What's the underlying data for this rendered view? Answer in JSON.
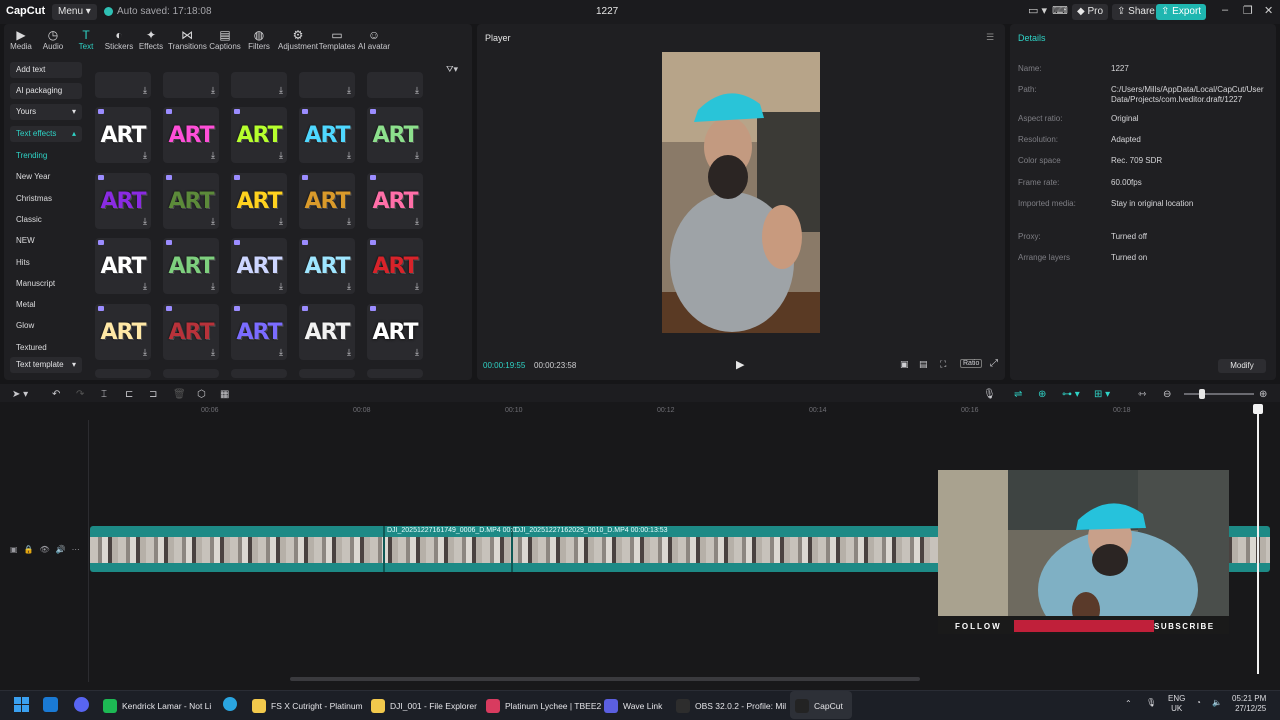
{
  "titlebar": {
    "logo": "CapCut",
    "menu": "Menu",
    "autosave": "Auto saved: 17:18:08",
    "project_title": "1227",
    "pro": "Pro",
    "share": "Share",
    "export": "Export"
  },
  "toolbar": [
    {
      "label": "Media",
      "icon": "media-icon"
    },
    {
      "label": "Audio",
      "icon": "audio-icon"
    },
    {
      "label": "Text",
      "icon": "text-icon",
      "active": true
    },
    {
      "label": "Stickers",
      "icon": "stickers-icon"
    },
    {
      "label": "Effects",
      "icon": "effects-icon"
    },
    {
      "label": "Transitions",
      "icon": "transitions-icon"
    },
    {
      "label": "Captions",
      "icon": "captions-icon"
    },
    {
      "label": "Filters",
      "icon": "filters-icon"
    },
    {
      "label": "Adjustment",
      "icon": "adjustment-icon"
    },
    {
      "label": "Templates",
      "icon": "templates-icon"
    },
    {
      "label": "AI avatar",
      "icon": "ai-avatar-icon"
    }
  ],
  "sidebar": {
    "add_text": "Add text",
    "ai_packaging": "AI packaging",
    "yours": "Yours",
    "text_effects": "Text effects",
    "categories": [
      "Trending",
      "New Year",
      "Christmas",
      "Classic",
      "NEW",
      "Hits",
      "Manuscript",
      "Metal",
      "Glow",
      "Textured"
    ],
    "text_template": "Text template"
  },
  "effects_grid": {
    "tile_text": "ART",
    "colors": [
      "#ffffff",
      "#ff4fd8",
      "#b6ff2e",
      "#4fd8ff",
      "#8de08d",
      "#8a2be2",
      "#5c8a3a",
      "#ffd21f",
      "#d99a2b",
      "#ff6fa8",
      "#ffffff",
      "#7ed07e",
      "#cdd6ff",
      "#9fe6ff",
      "#d8232a",
      "#ffe8a6",
      "#b8323a",
      "#7b6cff",
      "#f2f2f2",
      "#ffffff"
    ]
  },
  "player": {
    "title": "Player",
    "current_time": "00:00:19:55",
    "total_time": "00:00:23:58",
    "ratio": "Ratio"
  },
  "details": {
    "title": "Details",
    "rows": [
      {
        "label": "Name:",
        "value": "1227"
      },
      {
        "label": "Path:",
        "value": "C:/Users/Mills/AppData/Local/CapCut/User Data/Projects/com.lveditor.draft/1227"
      },
      {
        "label": "Aspect ratio:",
        "value": "Original"
      },
      {
        "label": "Resolution:",
        "value": "Adapted"
      },
      {
        "label": "Color space",
        "value": "Rec. 709 SDR"
      },
      {
        "label": "Frame rate:",
        "value": "60.00fps"
      },
      {
        "label": "Imported media:",
        "value": "Stay in original location"
      },
      {
        "label": "Proxy:",
        "value": "Turned off"
      },
      {
        "label": "Arrange layers",
        "value": "Turned on"
      }
    ],
    "modify": "Modify"
  },
  "timeline": {
    "ruler": [
      "00:06",
      "00:08",
      "00:10",
      "00:12",
      "00:14",
      "00:16",
      "00:18"
    ],
    "clip1": "DJI_20251227161749_0006_D.MP4  00:0",
    "clip2": "DJI_20251227162029_0010_D.MP4  00:00:13:53"
  },
  "overlay": {
    "follow": "FOLLOW",
    "subscribe": "SUBSCRIBE"
  },
  "taskbar": {
    "apps": [
      "Kendrick Lamar - Not Li",
      "FS X Cutright - Platinum",
      "DJI_001 - File Explorer",
      "Platinum Lychee | TBEE2",
      "Wave Link",
      "OBS 32.0.2 - Profile: Mil",
      "CapCut"
    ],
    "lang": "ENG",
    "region": "UK",
    "time": "05:21 PM",
    "date": "27/12/25"
  }
}
